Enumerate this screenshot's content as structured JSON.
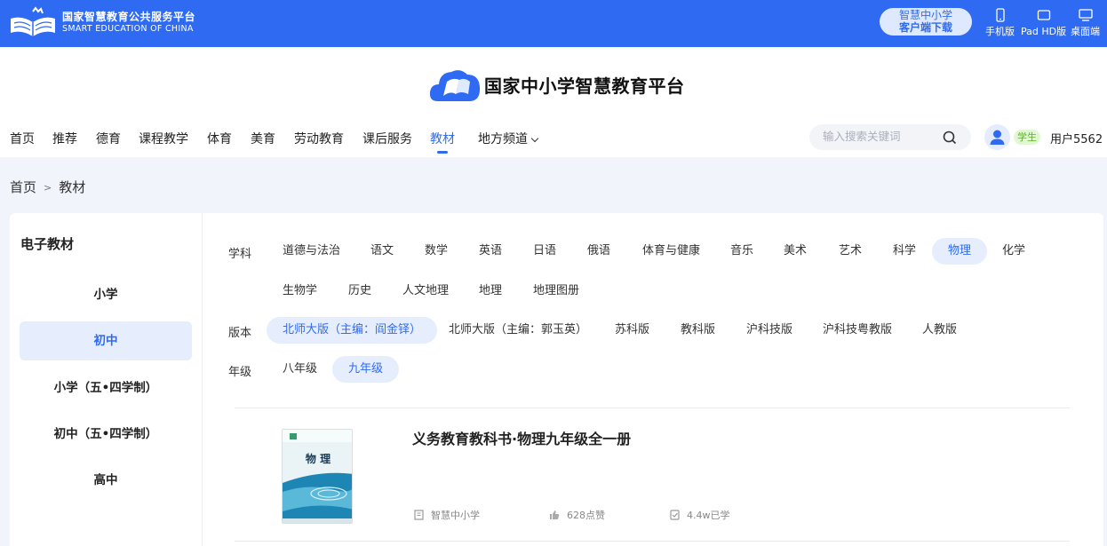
{
  "topbar": {
    "brand_cn": "国家智慧教育公共服务平台",
    "brand_en": "SMART EDUCATION OF CHINA",
    "download_line1": "智慧中小学",
    "download_line2": "客户端下载",
    "devices": [
      "手机版",
      "Pad HD版",
      "桌面端"
    ]
  },
  "header": {
    "site_title": "国家中小学智慧教育平台",
    "nav": [
      {
        "label": "首页"
      },
      {
        "label": "推荐"
      },
      {
        "label": "德育"
      },
      {
        "label": "课程教学"
      },
      {
        "label": "体育"
      },
      {
        "label": "美育"
      },
      {
        "label": "劳动教育"
      },
      {
        "label": "课后服务"
      },
      {
        "label": "教材",
        "active": true
      },
      {
        "label": "地方频道"
      }
    ],
    "search_placeholder": "输入搜索关键词",
    "role_badge": "学生",
    "username": "用户5562"
  },
  "breadcrumb": [
    "首页",
    "教材"
  ],
  "sidebar": {
    "title": "电子教材",
    "stages": [
      "小学",
      "初中",
      "小学（五•四学制）",
      "初中（五•四学制）",
      "高中"
    ],
    "active_stage": "初中"
  },
  "filters": {
    "subject_label": "学科",
    "subjects_row1": [
      "道德与法治",
      "语文",
      "数学",
      "英语",
      "日语",
      "俄语",
      "体育与健康",
      "音乐",
      "美术",
      "艺术",
      "科学",
      "物理",
      "化学"
    ],
    "subjects_row2": [
      "生物学",
      "历史",
      "人文地理",
      "地理",
      "地理图册"
    ],
    "active_subject": "物理",
    "edition_label": "版本",
    "editions": [
      "北师大版（主编：阎金铎）",
      "北师大版（主编：郭玉英）",
      "苏科版",
      "教科版",
      "沪科技版",
      "沪科技粤教版",
      "人教版"
    ],
    "active_edition": "北师大版（主编：阎金铎）",
    "grade_label": "年级",
    "grades": [
      "八年级",
      "九年级"
    ],
    "active_grade": "九年级"
  },
  "book": {
    "title": "义务教育教科书·物理九年级全一册",
    "cover_text": "物 理",
    "source": "智慧中小学",
    "likes": "628点赞",
    "learners": "4.4w已学"
  },
  "colors": {
    "primary": "#2f6bf2",
    "active_bg": "#e6eefd",
    "student_badge": "#5cb51f"
  }
}
